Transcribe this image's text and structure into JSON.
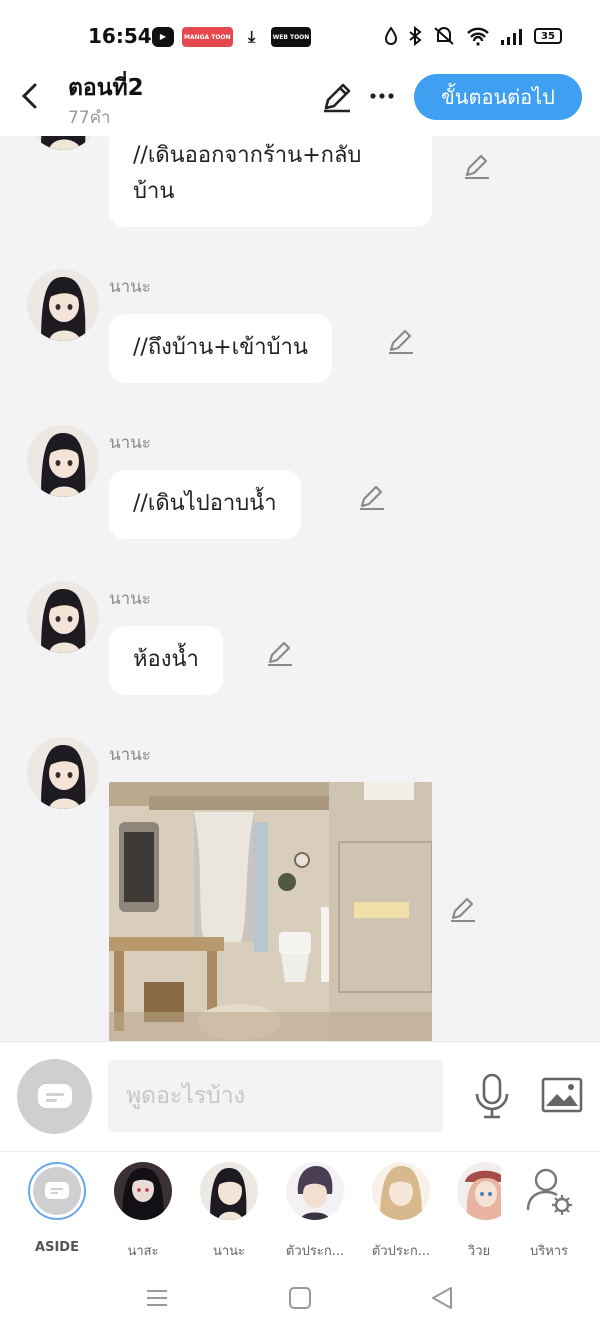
{
  "status_bar": {
    "time": "16:54",
    "apps": [
      {
        "icon": "youtube-icon",
        "label": "▶",
        "color": "#111111"
      },
      {
        "icon": "mangatoon-icon",
        "label": "MANGA TOON",
        "color": "#e5484d"
      },
      {
        "icon": "download-icon",
        "label": "⤓",
        "color": "#111111"
      },
      {
        "icon": "webtoon-icon",
        "label": "WEB TOON",
        "color": "#111111"
      }
    ],
    "battery": "35"
  },
  "header": {
    "title": "ตอนที่2",
    "word_count": "77คำ",
    "next_label": "ขั้นตอนต่อไป"
  },
  "messages": [
    {
      "sender": "",
      "text_lines": [
        "//เดินออกจากร้าน+กลับ",
        "บ้าน"
      ]
    },
    {
      "sender": "นานะ",
      "text_lines": [
        "//ถึงบ้าน+เข้าบ้าน"
      ]
    },
    {
      "sender": "นานะ",
      "text_lines": [
        "//เดินไปอาบน้ำ"
      ]
    },
    {
      "sender": "นานะ",
      "text_lines": [
        "ห้องน้ำ"
      ]
    },
    {
      "sender": "นานะ",
      "image": "bathroom-photo"
    }
  ],
  "input": {
    "placeholder": "พูดอะไรบ้าง"
  },
  "characters": [
    {
      "name": "ASIDE",
      "avatar": "aside-icon"
    },
    {
      "name": "นาสะ",
      "avatar": "nasa-avatar"
    },
    {
      "name": "นานะ",
      "avatar": "nana-avatar"
    },
    {
      "name": "ตัวประก...",
      "avatar": "character-avatar"
    },
    {
      "name": "ตัวประก...",
      "avatar": "character-avatar"
    },
    {
      "name": "วิวย",
      "avatar": "wiwy-avatar"
    },
    {
      "name": "บริหาร",
      "avatar": "manage-icon"
    }
  ],
  "colors": {
    "accent": "#3f9ff0",
    "background": "#f3f3f5",
    "bubble": "#ffffff",
    "sender": "#8a8a8a"
  }
}
